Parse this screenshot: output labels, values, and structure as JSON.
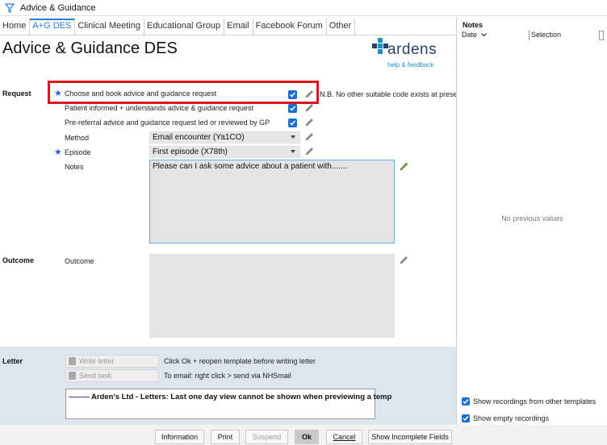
{
  "window": {
    "title": "Advice & Guidance"
  },
  "tabs": [
    {
      "label": "Home",
      "active": false
    },
    {
      "label": "A+G DES",
      "active": true
    },
    {
      "label": "Clinical Meeting",
      "active": false
    },
    {
      "label": "Educational Group",
      "active": false
    },
    {
      "label": "Email",
      "active": false
    },
    {
      "label": "Facebook Forum",
      "active": false
    },
    {
      "label": "Other",
      "active": false
    }
  ],
  "header": {
    "title": "Advice & Guidance DES",
    "logo": {
      "word": "ardens",
      "subtitle": "help & feedback"
    }
  },
  "request": {
    "section_label": "Request",
    "rows": [
      {
        "label": "Choose and book advice and guidance request",
        "checked": true,
        "required": true
      },
      {
        "label": "Patient informed + understands advice & guidance request",
        "checked": true,
        "required": false
      },
      {
        "label": "Pre-referral advice and guidance request led or reviewed by GP",
        "checked": true,
        "required": false
      }
    ],
    "nb_note": "N.B. No other suitable code exists at present",
    "method": {
      "label": "Method",
      "value": "Email encounter (Ya1CO)"
    },
    "episode": {
      "label": "Episode",
      "value": "First episode (X78th)",
      "required": true
    },
    "notes": {
      "label": "Notes",
      "value": "Please can I ask some advice about a patient with......."
    }
  },
  "outcome": {
    "section_label": "Outcome",
    "field_label": "Outcome",
    "value": ""
  },
  "letter": {
    "section_label": "Letter",
    "write_letter_label": "Write letter",
    "write_letter_hint": "Click Ok + reopen template before writing letter",
    "send_task_label": "Send task",
    "send_task_hint": "To email: right click > send via NHSmail",
    "preview_text": "Arden's Ltd - Letters: Last one day view cannot be shown when previewing a temp"
  },
  "buttons": {
    "information": "Information",
    "print": "Print",
    "suspend": "Suspend",
    "ok": "Ok",
    "cancel": "Cancel",
    "show_incomplete": "Show Incomplete Fields"
  },
  "notes_panel": {
    "title": "Notes",
    "col_date": "Date",
    "col_selection": "Selection",
    "empty_text": "No previous values",
    "show_other_templates": {
      "label": "Show recordings from other templates",
      "checked": true
    },
    "show_empty": {
      "label": "Show empty recordings",
      "checked": true
    }
  },
  "colors": {
    "accent": "#2a7dd4",
    "checkbox": "#1b6fd1",
    "highlight": "#e0141c",
    "logo_primary": "#2a3f6b",
    "logo_secondary": "#1f8fc9",
    "letter_bg": "#dde6ef"
  }
}
